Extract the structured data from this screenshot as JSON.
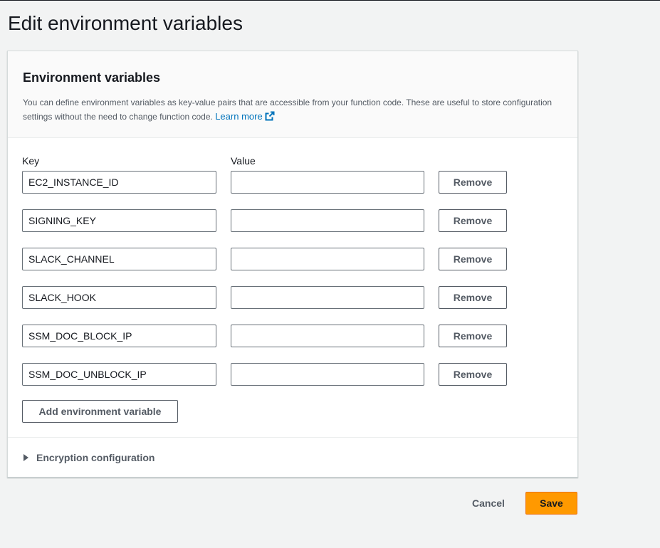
{
  "page": {
    "title": "Edit environment variables"
  },
  "section": {
    "title": "Environment variables",
    "description": "You can define environment variables as key-value pairs that are accessible from your function code. These are useful to store configuration settings without the need to change function code.",
    "learn_more": "Learn more"
  },
  "columns": {
    "key": "Key",
    "value": "Value"
  },
  "variables": [
    {
      "key": "EC2_INSTANCE_ID",
      "value": "",
      "remove_label": "Remove"
    },
    {
      "key": "SIGNING_KEY",
      "value": "",
      "remove_label": "Remove"
    },
    {
      "key": "SLACK_CHANNEL",
      "value": "",
      "remove_label": "Remove"
    },
    {
      "key": "SLACK_HOOK",
      "value": "",
      "remove_label": "Remove"
    },
    {
      "key": "SSM_DOC_BLOCK_IP",
      "value": "",
      "remove_label": "Remove"
    },
    {
      "key": "SSM_DOC_UNBLOCK_IP",
      "value": "",
      "remove_label": "Remove"
    }
  ],
  "add_button": "Add environment variable",
  "encryption": {
    "label": "Encryption configuration"
  },
  "footer": {
    "cancel": "Cancel",
    "save": "Save"
  },
  "icons": {
    "external_link": "external-link-icon",
    "expand_caret": "caret-right-icon"
  },
  "colors": {
    "accent_link": "#0073bb",
    "primary_button": "#ff9900",
    "primary_button_border": "#ec7211",
    "page_background": "#f2f3f3"
  }
}
